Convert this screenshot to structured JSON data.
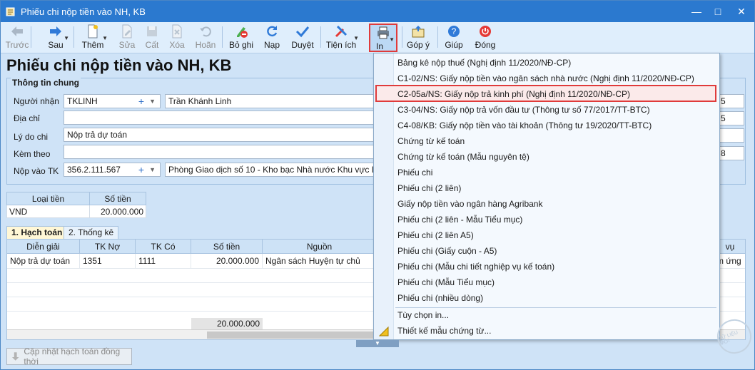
{
  "window": {
    "title": "Phiếu chi nộp tiền vào NH, KB"
  },
  "toolbar": {
    "prev": "Trước",
    "next": "Sau",
    "add": "Thêm",
    "edit": "Sửa",
    "save": "Cất",
    "delete": "Xóa",
    "undo": "Hoãn",
    "post": "Bỏ ghi",
    "reload": "Nạp",
    "approve": "Duyệt",
    "utilities": "Tiện ích",
    "print": "In",
    "feedback": "Góp ý",
    "help": "Giúp",
    "close": "Đóng"
  },
  "page_title": "Phiếu chi nộp tiền vào NH, KB",
  "general": {
    "group_label": "Thông tin chung",
    "recipient_label": "Người nhận",
    "recipient_code": "TKLINH",
    "recipient_name": "Trần Khánh Linh",
    "address_label": "Địa chỉ",
    "address_value": "",
    "reason_label": "Lý do chi",
    "reason_value": "Nộp trả dự toán",
    "attach_label": "Kèm theo",
    "attach_value": "",
    "account_label": "Nộp vào TK",
    "account_value": "356.2.111.567",
    "account_bank": "Phòng Giao dịch số 10 - Kho bạc Nhà nước Khu vực I",
    "right_field_1": "5",
    "right_field_2": "5",
    "right_field_4": "8"
  },
  "currency": {
    "col_type": "Loại tiền",
    "col_amount": "Số tiền",
    "type": "VND",
    "amount": "20.000.000"
  },
  "tabs": {
    "accounting": "1. Hạch toán",
    "stats": "2. Thống kê"
  },
  "grid": {
    "headers": [
      "Diễn giải",
      "TK Nợ",
      "TK Có",
      "Số tiền",
      "Nguồn",
      "vụ"
    ],
    "row": {
      "desc": "Nộp trả dự toán",
      "debit": "1351",
      "credit": "1111",
      "amount": "20.000.000",
      "source": "Ngân sách Huyện tự chủ",
      "tail": "m ứng"
    },
    "total": "20.000.000"
  },
  "update_button": "Cập nhật hạch toán đồng thời",
  "print_menu": {
    "items": [
      "Bảng kê nộp thuế (Nghị định 11/2020/NĐ-CP)",
      "C1-02/NS: Giấy nộp tiền vào ngân sách nhà nước (Nghị định 11/2020/NĐ-CP)",
      "C2-05a/NS: Giấy nộp trả kinh phí (Nghị định 11/2020/NĐ-CP)",
      "C3-04/NS: Giấy nộp trả vốn đầu tư (Thông tư số 77/2017/TT-BTC)",
      "C4-08/KB: Giấy nộp tiền vào tài khoản (Thông tư 19/2020/TT-BTC)",
      "Chứng từ kế toán",
      "Chứng từ kế toán (Mẫu nguyên tệ)",
      "Phiếu chi",
      "Phiếu chi (2 liên)",
      "Giấy nộp tiền vào ngân hàng Agribank",
      "Phiếu chi (2 liên - Mẫu Tiểu mục)",
      "Phiếu chi (2 liên A5)",
      "Phiếu chi (Giấy cuộn - A5)",
      "Phiếu chi (Mẫu chi tiết nghiệp vụ kế toán)",
      "Phiếu chi (Mẫu Tiểu mục)",
      "Phiếu chi (nhiều dòng)"
    ],
    "options": "Tùy chọn in...",
    "designer": "Thiết kế mẫu chứng từ..."
  },
  "colors": {
    "highlight": "#e03b3b",
    "titlebar": "#2b79cf"
  }
}
